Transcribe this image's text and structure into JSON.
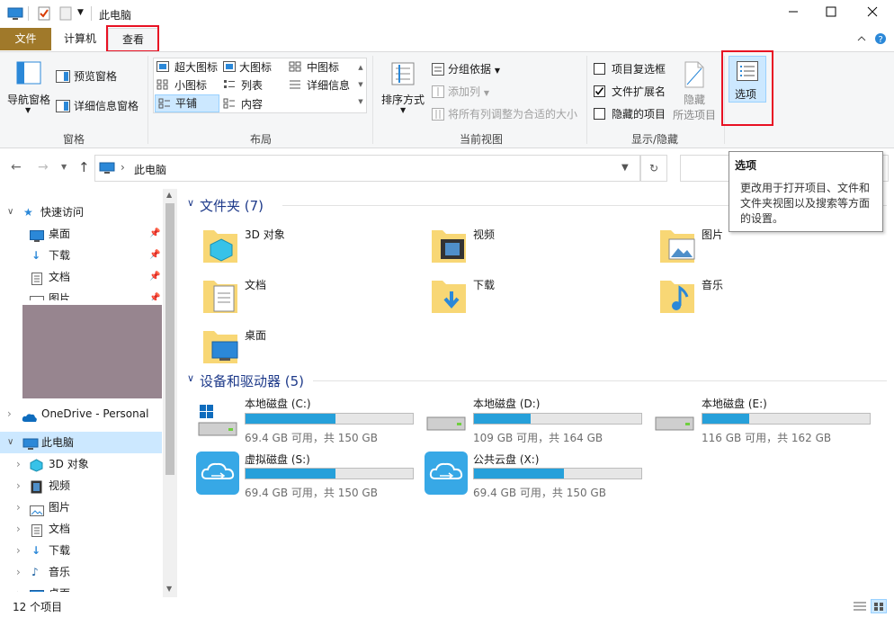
{
  "window": {
    "title": "此电脑"
  },
  "tabs": [
    {
      "label": "文件"
    },
    {
      "label": "计算机"
    },
    {
      "label": "查看"
    }
  ],
  "ribbon": {
    "pane": {
      "nav_pane": "导航窗格",
      "preview_pane": "预览窗格",
      "details_pane": "详细信息窗格",
      "group_label": "窗格"
    },
    "layout": {
      "items": [
        "超大图标",
        "大图标",
        "中图标",
        "小图标",
        "列表",
        "详细信息",
        "平铺",
        "内容"
      ],
      "group_label": "布局"
    },
    "current_view": {
      "sort": "排序方式",
      "group_by": "分组依据",
      "add_column": "添加列",
      "fit_columns": "将所有列调整为合适的大小",
      "group_label": "当前视图"
    },
    "show_hide": {
      "item_checkbox": "项目复选框",
      "file_ext": "文件扩展名",
      "hidden_items": "隐藏的项目",
      "hide_selected_line1": "隐藏",
      "hide_selected_line2": "所选项目",
      "group_label": "显示/隐藏"
    },
    "options": {
      "label": "选项"
    }
  },
  "address": {
    "path_root": "此电脑"
  },
  "tooltip": {
    "title": "选项",
    "body": "更改用于打开项目、文件和文件夹视图以及搜索等方面的设置。"
  },
  "nav": {
    "quick_access": "快速访问",
    "quick_items": [
      "桌面",
      "下载",
      "文档",
      "图片"
    ],
    "onedrive": "OneDrive - Personal",
    "this_pc": "此电脑",
    "pc_items": [
      "3D 对象",
      "视频",
      "图片",
      "文档",
      "下载",
      "音乐",
      "桌面"
    ]
  },
  "folders_section": {
    "title": "文件夹 (7)",
    "items": [
      "3D 对象",
      "视频",
      "图片",
      "文档",
      "下载",
      "音乐",
      "桌面"
    ]
  },
  "drives_section": {
    "title": "设备和驱动器 (5)",
    "items": [
      {
        "name": "本地磁盘 (C:)",
        "info": "69.4 GB 可用，共 150 GB",
        "used_fraction": 0.54
      },
      {
        "name": "本地磁盘 (D:)",
        "info": "109 GB 可用，共 164 GB",
        "used_fraction": 0.34
      },
      {
        "name": "本地磁盘 (E:)",
        "info": "116 GB 可用，共 162 GB",
        "used_fraction": 0.28
      },
      {
        "name": "虚拟磁盘 (S:)",
        "info": "69.4 GB 可用，共 150 GB",
        "used_fraction": 0.54
      },
      {
        "name": "公共云盘 (X:)",
        "info": "69.4 GB 可用，共 150 GB",
        "used_fraction": 0.54
      }
    ]
  },
  "status": {
    "count": "12 个项目"
  },
  "colors": {
    "file_tab": "#a0792a",
    "accent": "#26a0da",
    "highlight": "#e81123",
    "selected": "#cce8ff"
  }
}
